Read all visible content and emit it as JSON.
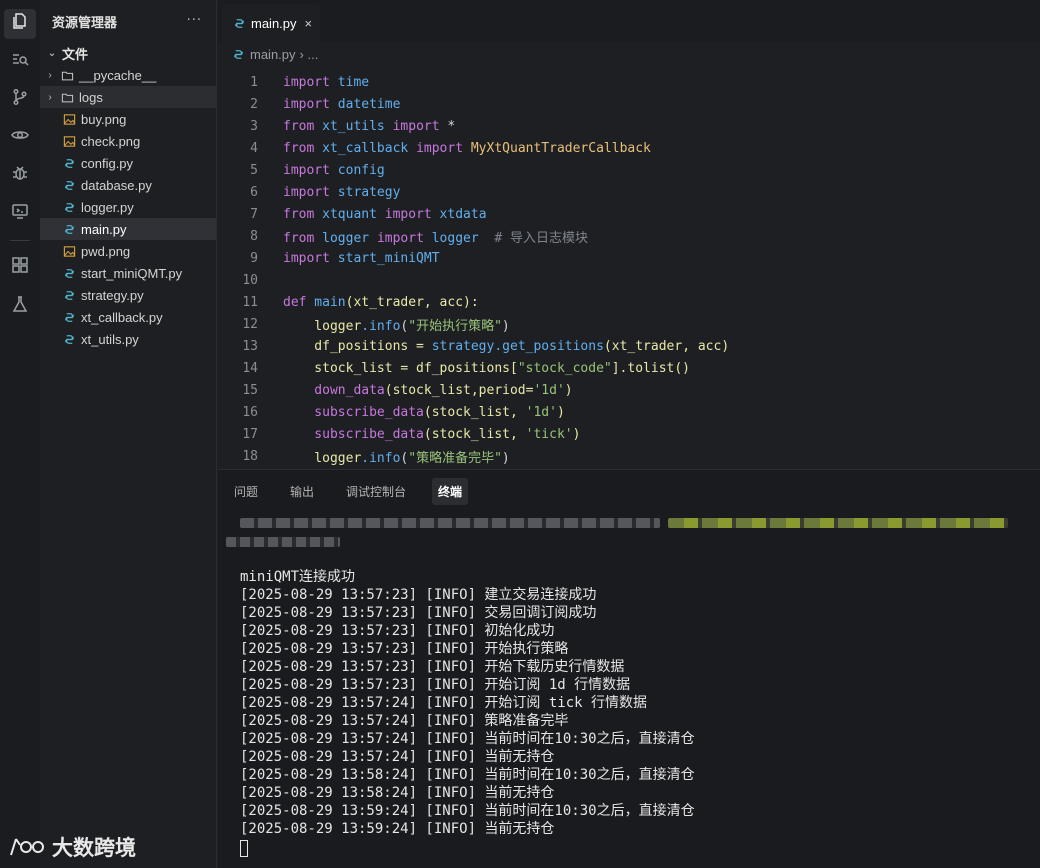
{
  "sidebar": {
    "title": "资源管理器",
    "more": "···",
    "root": "文件",
    "items": [
      {
        "label": "__pycache__",
        "kind": "folder"
      },
      {
        "label": "logs",
        "kind": "folder"
      },
      {
        "label": "buy.png",
        "kind": "image"
      },
      {
        "label": "check.png",
        "kind": "image"
      },
      {
        "label": "config.py",
        "kind": "python"
      },
      {
        "label": "database.py",
        "kind": "python"
      },
      {
        "label": "logger.py",
        "kind": "python"
      },
      {
        "label": "main.py",
        "kind": "python"
      },
      {
        "label": "pwd.png",
        "kind": "image"
      },
      {
        "label": "start_miniQMT.py",
        "kind": "python"
      },
      {
        "label": "strategy.py",
        "kind": "python"
      },
      {
        "label": "xt_callback.py",
        "kind": "python"
      },
      {
        "label": "xt_utils.py",
        "kind": "python"
      }
    ]
  },
  "editor": {
    "tab": "main.py",
    "tab_close": "×",
    "breadcrumb_file": "main.py",
    "breadcrumb_more": "›  ...",
    "line_numbers": [
      "1",
      "2",
      "3",
      "4",
      "5",
      "6",
      "7",
      "8",
      "9",
      "10",
      "11",
      "12",
      "13",
      "14",
      "15",
      "16",
      "17",
      "18"
    ]
  },
  "panel": {
    "tabs": [
      "问题",
      "输出",
      "调试控制台",
      "终端"
    ],
    "terminal_lines": [
      "miniQMT连接成功",
      "[2025-08-29 13:57:23] [INFO] 建立交易连接成功",
      "[2025-08-29 13:57:23] [INFO] 交易回调订阅成功",
      "[2025-08-29 13:57:23] [INFO] 初始化成功",
      "[2025-08-29 13:57:23] [INFO] 开始执行策略",
      "[2025-08-29 13:57:23] [INFO] 开始下载历史行情数据",
      "[2025-08-29 13:57:23] [INFO] 开始订阅 1d 行情数据",
      "[2025-08-29 13:57:24] [INFO] 开始订阅 tick 行情数据",
      "[2025-08-29 13:57:24] [INFO] 策略准备完毕",
      "[2025-08-29 13:57:24] [INFO] 当前时间在10:30之后，直接清仓",
      "[2025-08-29 13:57:24] [INFO] 当前无持仓",
      "[2025-08-29 13:58:24] [INFO] 当前时间在10:30之后，直接清仓",
      "[2025-08-29 13:58:24] [INFO] 当前无持仓",
      "[2025-08-29 13:59:24] [INFO] 当前时间在10:30之后，直接清仓",
      "[2025-08-29 13:59:24] [INFO] 当前无持仓"
    ]
  },
  "code": {
    "l1": [
      "import",
      " time"
    ],
    "l2": [
      "import",
      " datetime"
    ],
    "l3": [
      "from",
      " xt_utils ",
      "import",
      " *"
    ],
    "l4": [
      "from",
      " xt_callback ",
      "import",
      " MyXtQuantTraderCallback"
    ],
    "l5": [
      "import",
      " config"
    ],
    "l6": [
      "import",
      " strategy"
    ],
    "l7": [
      "from",
      " xtquant ",
      "import",
      " xtdata"
    ],
    "l8": [
      "from",
      " logger ",
      "import",
      " logger",
      "  # 导入日志模块"
    ],
    "l9": [
      "import",
      " start_miniQMT"
    ],
    "l11": [
      "def",
      " main",
      "(xt_trader, acc):"
    ],
    "l12": [
      "    logger",
      ".info",
      "(",
      "\"开始执行策略\"",
      ")"
    ],
    "l13": [
      "    df_positions = ",
      "strategy",
      ".get_positions",
      "(xt_trader, acc)"
    ],
    "l14": [
      "    stock_list = df_positions[",
      "\"stock_code\"",
      "].tolist()"
    ],
    "l15": [
      "    down_data",
      "(stock_list,period=",
      "'1d'",
      ")"
    ],
    "l16": [
      "    subscribe_data",
      "(stock_list, ",
      "'1d'",
      ")"
    ],
    "l17": [
      "    subscribe_data",
      "(stock_list, ",
      "'tick'",
      ")"
    ],
    "l18": [
      "    logger",
      ".info",
      "(",
      "\"策略准备完毕\"",
      ")"
    ]
  },
  "watermark": "大数跨境"
}
